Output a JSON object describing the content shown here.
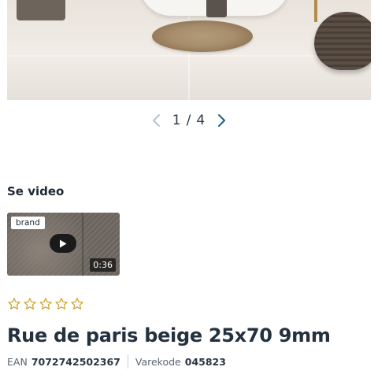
{
  "gallery": {
    "current": "1",
    "separator": "/",
    "total": "4",
    "prev_icon": "chevron-left-icon",
    "next_icon": "chevron-right-icon"
  },
  "video": {
    "heading": "Se video",
    "badge": "brand",
    "duration": "0:36",
    "play_icon": "play-icon"
  },
  "rating": {
    "value": 0,
    "max": 5,
    "star_color": "#c9a227"
  },
  "product": {
    "title": "Rue de paris beige 25x70 9mm",
    "ean_label": "EAN",
    "ean_value": "7072742502367",
    "item_code_label": "Varekode",
    "item_code_value": "045823"
  }
}
